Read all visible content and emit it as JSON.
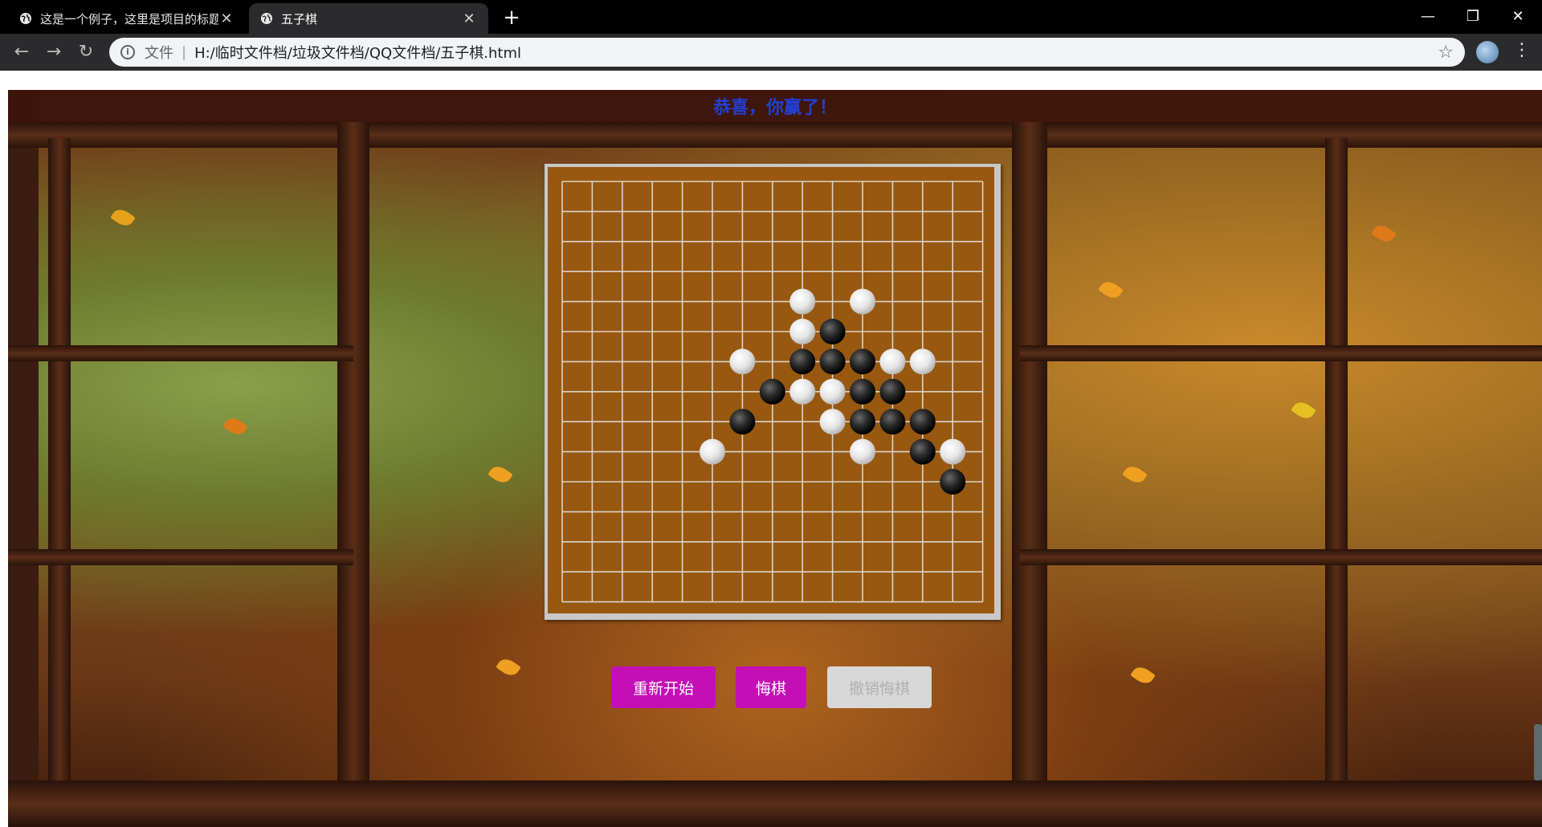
{
  "browser": {
    "tabs": [
      {
        "title": "这是一个例子，这里是项目的标题",
        "active": false
      },
      {
        "title": "五子棋",
        "active": true
      }
    ],
    "address": {
      "scheme_label": "文件",
      "url": "H:/临时文件档/垃圾文件档/QQ文件档/五子棋.html"
    },
    "icons": {
      "back": "back-arrow-icon",
      "forward": "forward-arrow-icon",
      "reload": "reload-icon",
      "info": "info-icon",
      "star": "star-icon",
      "globe": "globe-icon"
    }
  },
  "game": {
    "status_message": "恭喜，你赢了！",
    "grid_size": 15,
    "colors": {
      "board": "#98580f",
      "grid_line": "#d9d4cc",
      "message": "#2140d6",
      "button_active": "#c40fb6",
      "button_disabled": "#d8d8d8"
    },
    "stones": [
      {
        "col": 8,
        "row": 4,
        "color": "white"
      },
      {
        "col": 10,
        "row": 4,
        "color": "white"
      },
      {
        "col": 8,
        "row": 5,
        "color": "white"
      },
      {
        "col": 9,
        "row": 5,
        "color": "black"
      },
      {
        "col": 6,
        "row": 6,
        "color": "white"
      },
      {
        "col": 8,
        "row": 6,
        "color": "black"
      },
      {
        "col": 9,
        "row": 6,
        "color": "black"
      },
      {
        "col": 10,
        "row": 6,
        "color": "black"
      },
      {
        "col": 11,
        "row": 6,
        "color": "white"
      },
      {
        "col": 12,
        "row": 6,
        "color": "white"
      },
      {
        "col": 7,
        "row": 7,
        "color": "black"
      },
      {
        "col": 8,
        "row": 7,
        "color": "white"
      },
      {
        "col": 9,
        "row": 7,
        "color": "white"
      },
      {
        "col": 10,
        "row": 7,
        "color": "black"
      },
      {
        "col": 11,
        "row": 7,
        "color": "black"
      },
      {
        "col": 6,
        "row": 8,
        "color": "black"
      },
      {
        "col": 9,
        "row": 8,
        "color": "white"
      },
      {
        "col": 10,
        "row": 8,
        "color": "black"
      },
      {
        "col": 11,
        "row": 8,
        "color": "black"
      },
      {
        "col": 12,
        "row": 8,
        "color": "black"
      },
      {
        "col": 5,
        "row": 9,
        "color": "white"
      },
      {
        "col": 10,
        "row": 9,
        "color": "white"
      },
      {
        "col": 12,
        "row": 9,
        "color": "black"
      },
      {
        "col": 13,
        "row": 9,
        "color": "white"
      },
      {
        "col": 13,
        "row": 10,
        "color": "black"
      }
    ],
    "buttons": {
      "restart": "重新开始",
      "undo": "悔棋",
      "redo": "撤销悔棋"
    }
  }
}
